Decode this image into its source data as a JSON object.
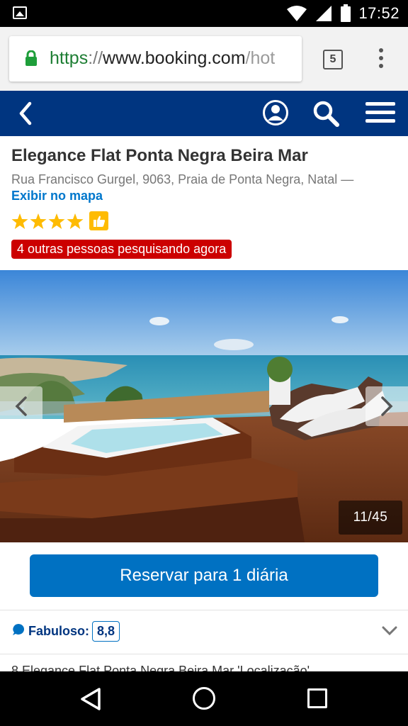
{
  "status_bar": {
    "time": "17:52",
    "icons": [
      "image-icon",
      "wifi-icon",
      "signal-icon",
      "battery-icon"
    ]
  },
  "browser": {
    "url_scheme": "https",
    "url_separator": "://",
    "url_domain": "www.booking.com",
    "url_path": "/hot",
    "tab_count": "5"
  },
  "header": {
    "brand_color": "#003580",
    "icons": [
      "back-icon",
      "account-icon",
      "search-icon",
      "menu-icon"
    ]
  },
  "hotel": {
    "name": "Elegance Flat Ponta Negra Beira Mar",
    "address": "Rua Francisco Gurgel, 9063, Praia de Ponta Negra, Natal —",
    "map_link": "Exibir no mapa",
    "stars": 4,
    "alert": "4 outras pessoas pesquisando agora"
  },
  "gallery": {
    "counter": "11/45",
    "current": 11,
    "total": 45
  },
  "reserve": {
    "label": "Reservar para 1 diária",
    "color": "#0071c2"
  },
  "review": {
    "label": "Fabuloso:",
    "score": "8,8"
  },
  "truncated_text": "8 Elegance Flat Ponta Negra Beira Mar 'Localização'"
}
